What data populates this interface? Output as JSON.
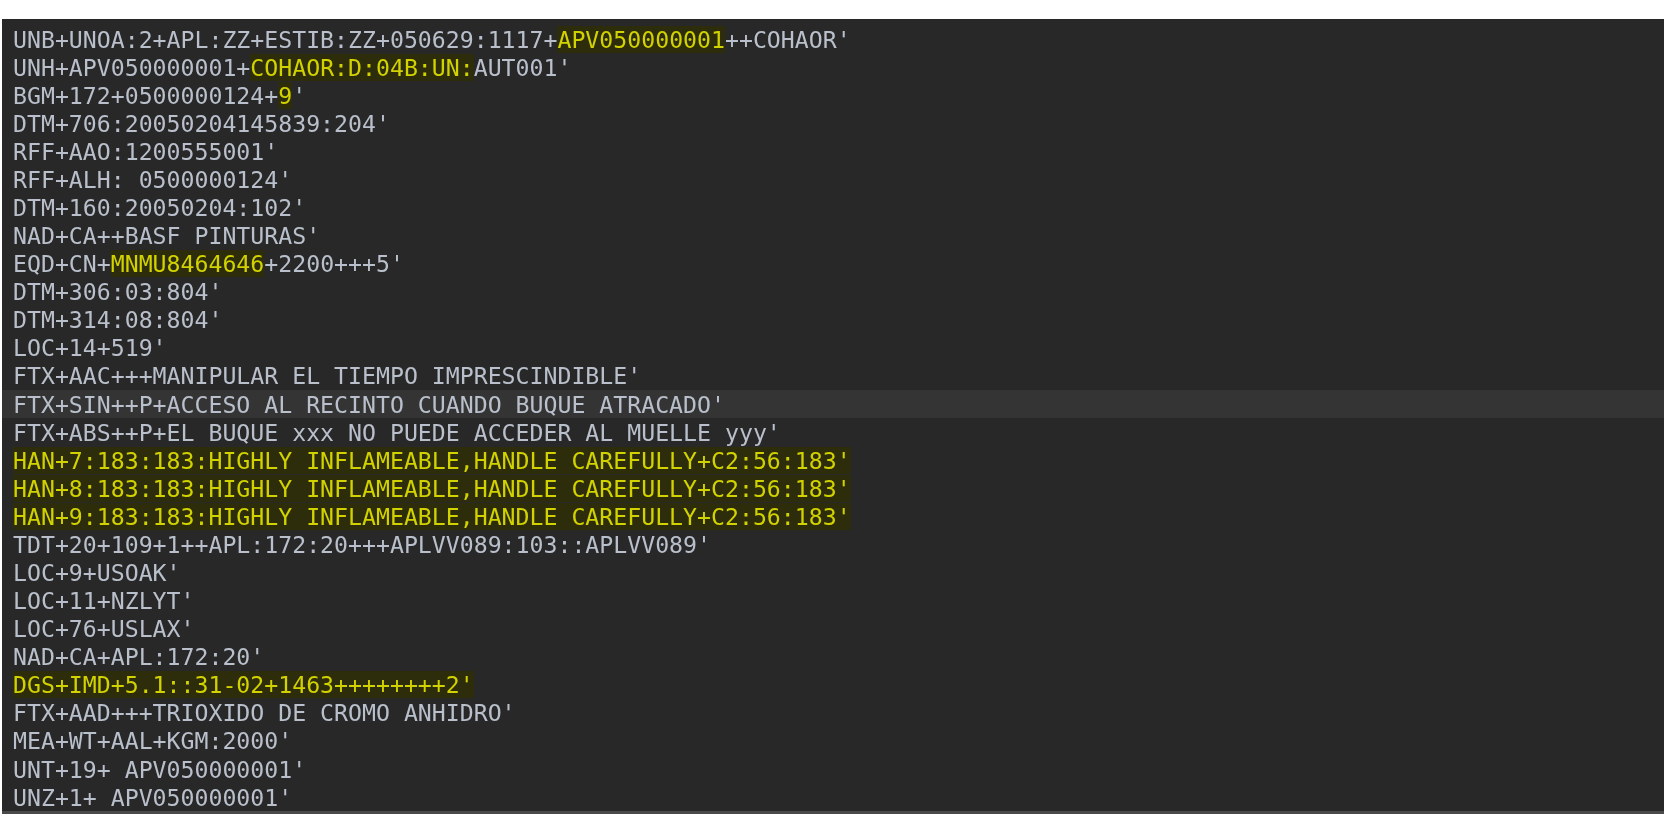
{
  "editor": {
    "lines": [
      {
        "current": false,
        "parts": [
          {
            "text": "UNB+UNOA:2+APL:ZZ+ESTIB:ZZ+050629:1117+",
            "highlighted": false
          },
          {
            "text": "APV050000001",
            "highlighted": true
          },
          {
            "text": "++COHAOR'",
            "highlighted": false
          }
        ]
      },
      {
        "current": false,
        "parts": [
          {
            "text": "UNH+APV050000001+",
            "highlighted": false
          },
          {
            "text": "COHAOR:D:04B:UN:",
            "highlighted": true
          },
          {
            "text": "AUT001'",
            "highlighted": false
          }
        ]
      },
      {
        "current": false,
        "parts": [
          {
            "text": "BGM+172+0500000124+",
            "highlighted": false
          },
          {
            "text": "9",
            "highlighted": true
          },
          {
            "text": "'",
            "highlighted": false
          }
        ]
      },
      {
        "current": false,
        "parts": [
          {
            "text": "DTM+706:20050204145839:204'",
            "highlighted": false
          }
        ]
      },
      {
        "current": false,
        "parts": [
          {
            "text": "RFF+AAO:1200555001'",
            "highlighted": false
          }
        ]
      },
      {
        "current": false,
        "parts": [
          {
            "text": "RFF+ALH: 0500000124'",
            "highlighted": false
          }
        ]
      },
      {
        "current": false,
        "parts": [
          {
            "text": "DTM+160:20050204:102'",
            "highlighted": false
          }
        ]
      },
      {
        "current": false,
        "parts": [
          {
            "text": "NAD+CA++BASF PINTURAS'",
            "highlighted": false
          }
        ]
      },
      {
        "current": false,
        "parts": [
          {
            "text": "EQD+CN+",
            "highlighted": false
          },
          {
            "text": "MNMU8464646",
            "highlighted": true
          },
          {
            "text": "+2200+++5'",
            "highlighted": false
          }
        ]
      },
      {
        "current": false,
        "parts": [
          {
            "text": "DTM+306:03:804'",
            "highlighted": false
          }
        ]
      },
      {
        "current": false,
        "parts": [
          {
            "text": "DTM+314:08:804'",
            "highlighted": false
          }
        ]
      },
      {
        "current": false,
        "parts": [
          {
            "text": "LOC+14+519'",
            "highlighted": false
          }
        ]
      },
      {
        "current": false,
        "parts": [
          {
            "text": "FTX+AAC+++MANIPULAR EL TIEMPO IMPRESCINDIBLE'",
            "highlighted": false
          }
        ]
      },
      {
        "current": true,
        "parts": [
          {
            "text": "FTX+SIN++P+ACCESO AL RECINTO CUANDO BUQUE ATRACADO'",
            "highlighted": false
          }
        ]
      },
      {
        "current": false,
        "parts": [
          {
            "text": "FTX+ABS++P+EL BUQUE xxx NO PUEDE ACCEDER AL MUELLE yyy'",
            "highlighted": false
          }
        ]
      },
      {
        "current": false,
        "parts": [
          {
            "text": "HAN+7:183:183:HIGHLY INFLAMEABLE,HANDLE CAREFULLY+C2:56:183'",
            "highlighted": true
          }
        ]
      },
      {
        "current": false,
        "parts": [
          {
            "text": "HAN+8:183:183:HIGHLY INFLAMEABLE,HANDLE CAREFULLY+C2:56:183'",
            "highlighted": true
          }
        ]
      },
      {
        "current": false,
        "parts": [
          {
            "text": "HAN+9:183:183:HIGHLY INFLAMEABLE,HANDLE CAREFULLY+C2:56:183'",
            "highlighted": true
          }
        ]
      },
      {
        "current": false,
        "parts": [
          {
            "text": "TDT+20+109+1++APL:172:20+++APLVV089:103::APLVV089'",
            "highlighted": false
          }
        ]
      },
      {
        "current": false,
        "parts": [
          {
            "text": "LOC+9+USOAK'",
            "highlighted": false
          }
        ]
      },
      {
        "current": false,
        "parts": [
          {
            "text": "LOC+11+NZLYT'",
            "highlighted": false
          }
        ]
      },
      {
        "current": false,
        "parts": [
          {
            "text": "LOC+76+USLAX'",
            "highlighted": false
          }
        ]
      },
      {
        "current": false,
        "parts": [
          {
            "text": "NAD+CA+APL:172:20'",
            "highlighted": false
          }
        ]
      },
      {
        "current": false,
        "parts": [
          {
            "text": "DGS+IMD+5.1::31-02+1463++++++++2'",
            "highlighted": true
          }
        ]
      },
      {
        "current": false,
        "parts": [
          {
            "text": "FTX+AAD+++TRIOXIDO DE CROMO ANHIDRO'",
            "highlighted": false
          }
        ]
      },
      {
        "current": false,
        "parts": [
          {
            "text": "MEA+WT+AAL+KGM:2000'",
            "highlighted": false
          }
        ]
      },
      {
        "current": false,
        "parts": [
          {
            "text": "UNT+19+ APV050000001'",
            "highlighted": false
          }
        ]
      },
      {
        "current": false,
        "parts": [
          {
            "text": "UNZ+1+ APV050000001'",
            "highlighted": false
          }
        ]
      }
    ]
  }
}
